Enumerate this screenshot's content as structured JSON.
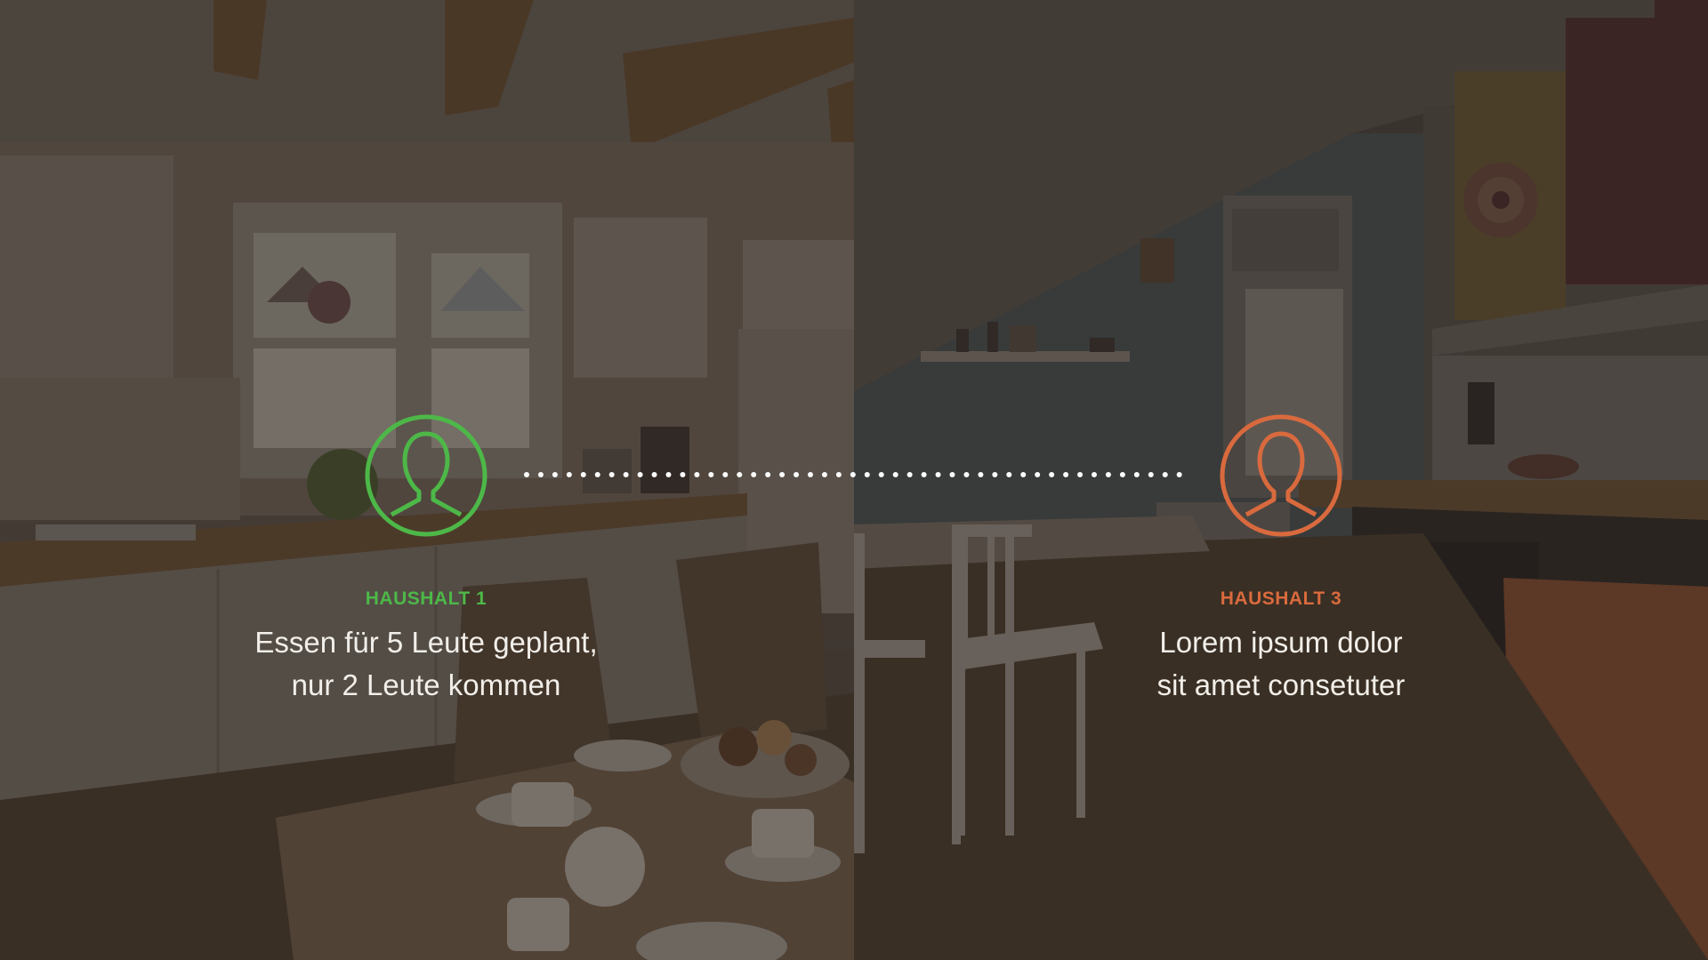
{
  "colors": {
    "household1_accent": "#4db848",
    "household3_accent": "#d96a3e",
    "connector_dots": "#ffffff",
    "text": "#f2efea"
  },
  "households": [
    {
      "label": "HAUSHALT 1",
      "line1": "Essen für 5 Leute geplant,",
      "line2": "nur 2 Leute kommen",
      "icon": "person-circle-icon"
    },
    {
      "label": "HAUSHALT 3",
      "line1": "Lorem ipsum dolor",
      "line2": "sit amet consetuter",
      "icon": "person-circle-icon"
    }
  ]
}
